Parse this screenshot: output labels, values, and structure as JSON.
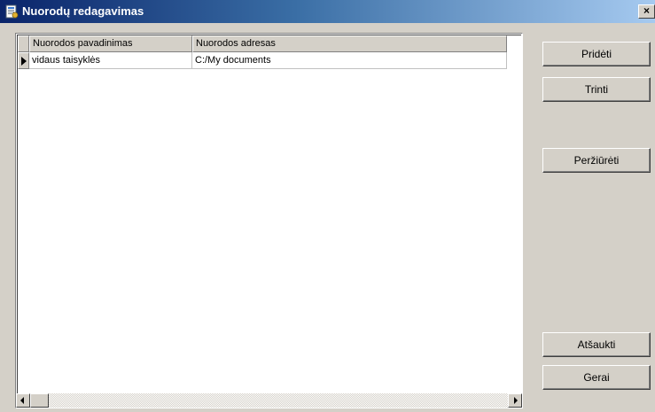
{
  "window": {
    "title": "Nuorodų redagavimas",
    "close_glyph": "×",
    "app_icon": "app-icon"
  },
  "grid": {
    "columns": [
      "Nuorodos pavadinimas",
      "Nuorodos adresas"
    ],
    "rows": [
      {
        "name": "vidaus taisyklės",
        "address": "C:/My documents",
        "current": true
      }
    ]
  },
  "buttons": {
    "add": "Pridėti",
    "delete": "Trinti",
    "view": "Peržiūrėti",
    "cancel": "Atšaukti",
    "ok": "Gerai"
  },
  "colors": {
    "title_start": "#0a246a",
    "title_end": "#a6caf0",
    "face": "#d4d0c8"
  }
}
